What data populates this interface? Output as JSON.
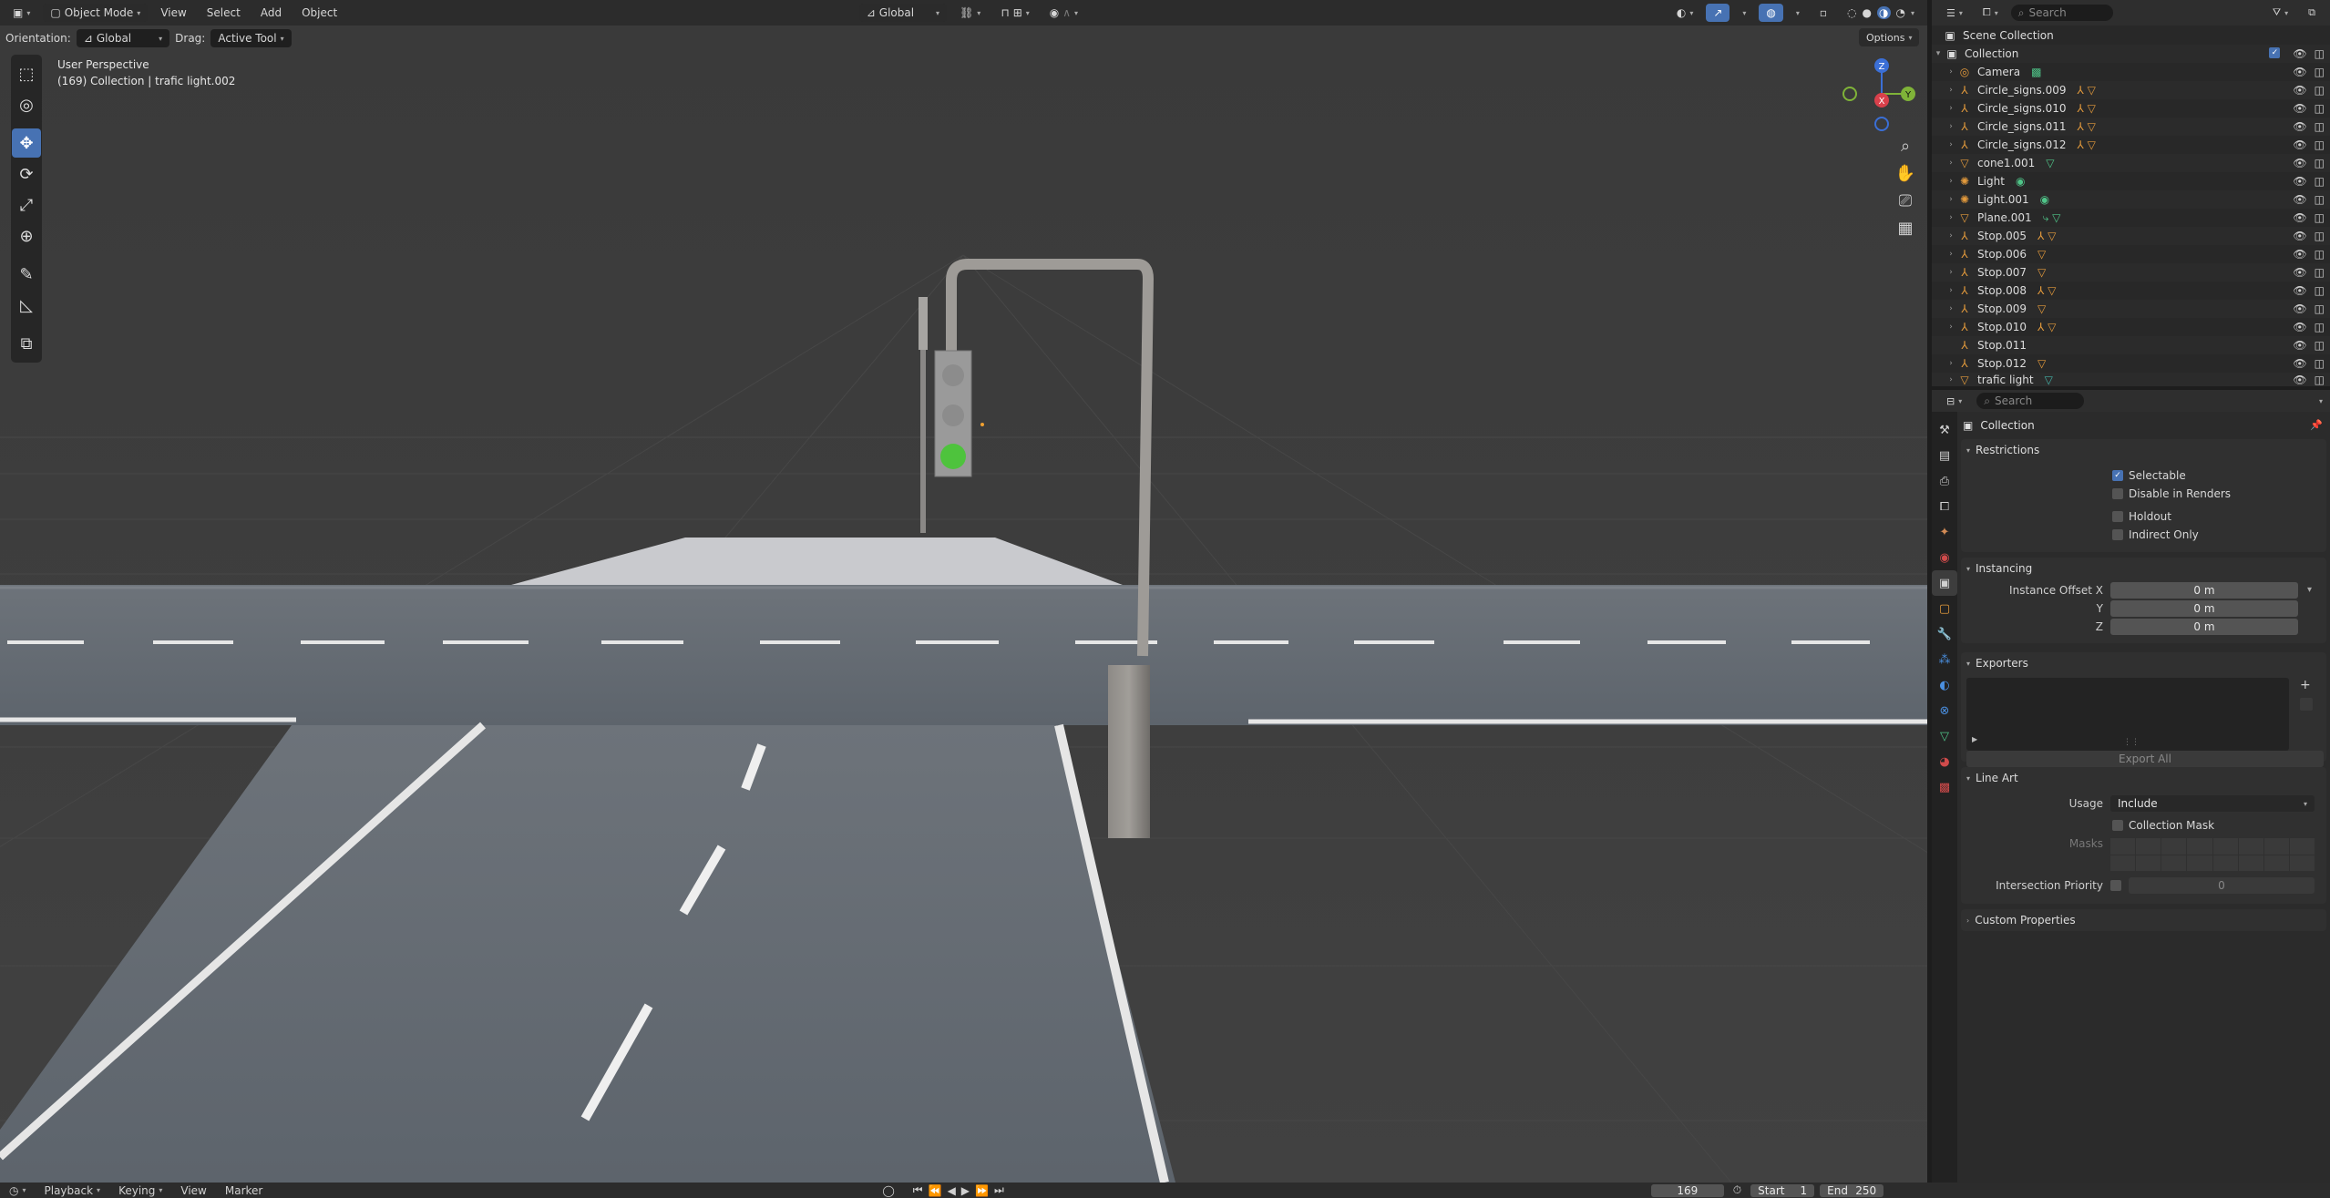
{
  "viewport_header": {
    "editor_icon": "cube-icon",
    "mode": "Object Mode",
    "menus": [
      "View",
      "Select",
      "Add",
      "Object"
    ],
    "transform_orientation": "Global",
    "orientation_label": "Orientation:",
    "orientation_value": "Global",
    "drag_label": "Drag:",
    "drag_value": "Active Tool",
    "options_label": "Options"
  },
  "viewport_overlay": {
    "view_name": "User Perspective",
    "context": "(169) Collection | trafic light.002"
  },
  "gizmo": {
    "z": "Z",
    "y": "Y",
    "x": "X"
  },
  "timeline": {
    "menus": [
      "Playback",
      "Keying",
      "View",
      "Marker"
    ],
    "current_frame": "169",
    "start_label": "Start",
    "start_value": "1",
    "end_label": "End",
    "end_value": "250"
  },
  "outliner": {
    "search_placeholder": "Search",
    "scene_collection": "Scene Collection",
    "collection": "Collection",
    "items": [
      {
        "name": "Camera",
        "icon": "camera-icon"
      },
      {
        "name": "Circle_signs.009",
        "icon": "empty-icon"
      },
      {
        "name": "Circle_signs.010",
        "icon": "empty-icon"
      },
      {
        "name": "Circle_signs.011",
        "icon": "empty-icon"
      },
      {
        "name": "Circle_signs.012",
        "icon": "empty-icon"
      },
      {
        "name": "cone1.001",
        "icon": "mesh-icon"
      },
      {
        "name": "Light",
        "icon": "light-icon"
      },
      {
        "name": "Light.001",
        "icon": "light-icon"
      },
      {
        "name": "Plane.001",
        "icon": "mesh-icon"
      },
      {
        "name": "Stop.005",
        "icon": "empty-icon"
      },
      {
        "name": "Stop.006",
        "icon": "empty-icon"
      },
      {
        "name": "Stop.007",
        "icon": "empty-icon"
      },
      {
        "name": "Stop.008",
        "icon": "empty-icon"
      },
      {
        "name": "Stop.009",
        "icon": "empty-icon"
      },
      {
        "name": "Stop.010",
        "icon": "empty-icon"
      },
      {
        "name": "Stop.011",
        "icon": "empty-icon"
      },
      {
        "name": "Stop.012",
        "icon": "empty-icon"
      },
      {
        "name": "trafic light",
        "icon": "mesh-icon"
      }
    ]
  },
  "properties": {
    "search_placeholder": "Search",
    "title": "Collection",
    "restrictions": {
      "header": "Restrictions",
      "selectable": "Selectable",
      "disable_in_renders": "Disable in Renders",
      "holdout": "Holdout",
      "indirect_only": "Indirect Only"
    },
    "instancing": {
      "header": "Instancing",
      "offset_x_label": "Instance Offset X",
      "y_label": "Y",
      "z_label": "Z",
      "x_value": "0 m",
      "y_value": "0 m",
      "z_value": "0 m"
    },
    "exporters": {
      "header": "Exporters",
      "export_all": "Export All"
    },
    "line_art": {
      "header": "Line Art",
      "usage_label": "Usage",
      "usage_value": "Include",
      "collection_mask": "Collection Mask",
      "masks_label": "Masks",
      "intersection_label": "Intersection Priority",
      "intersection_value": "0"
    },
    "custom_properties": "Custom Properties"
  }
}
